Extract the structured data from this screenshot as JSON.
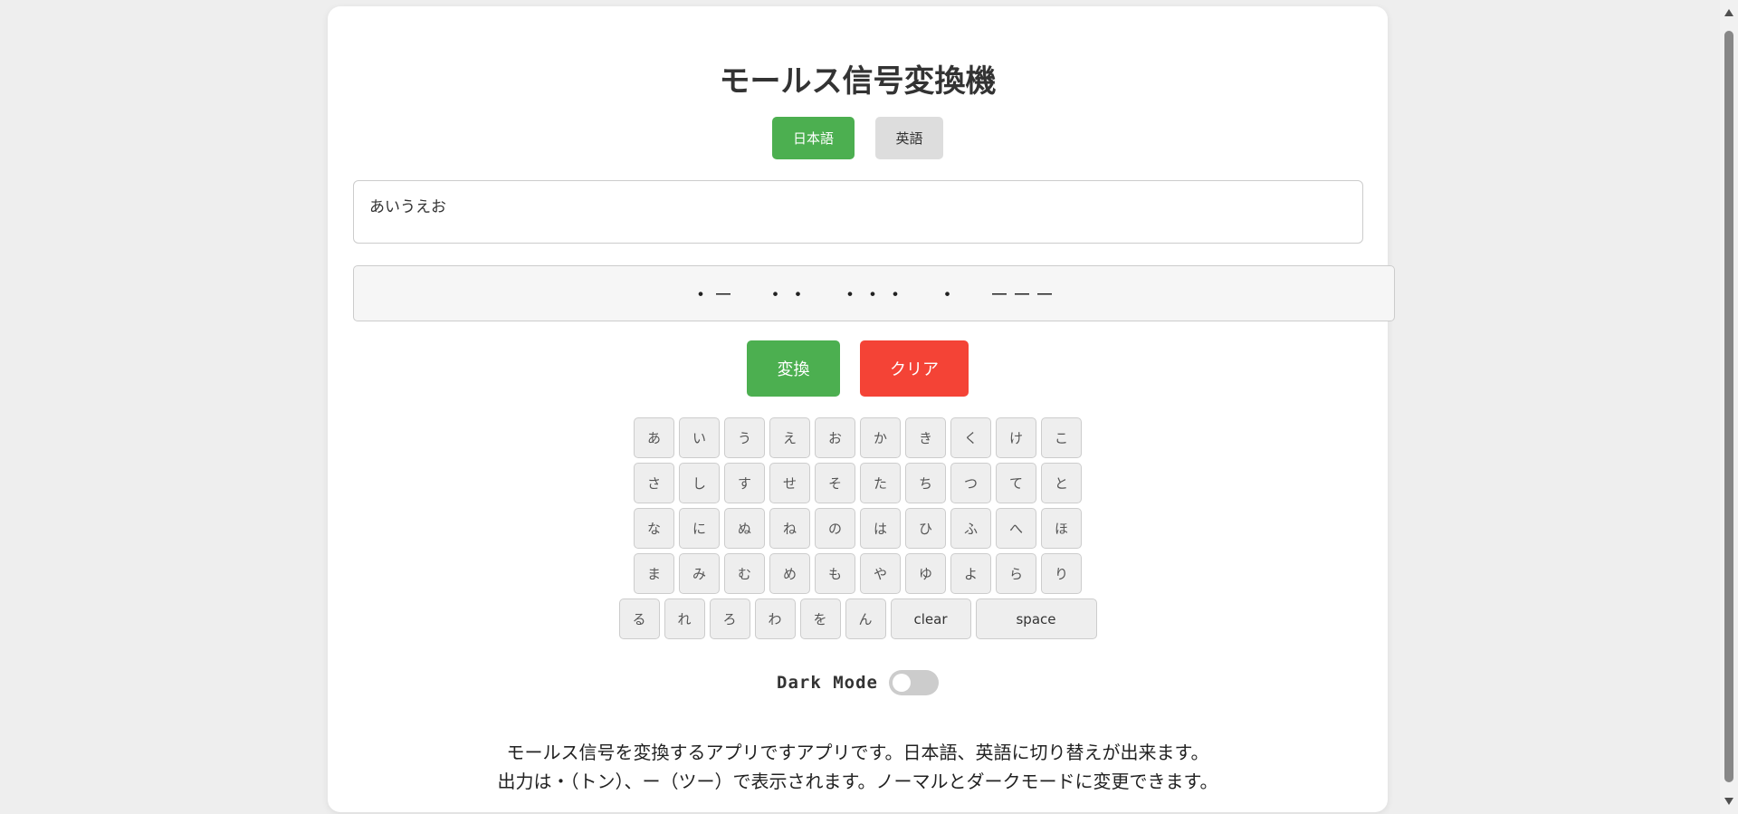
{
  "title": "モールス信号変換機",
  "lang": {
    "japanese": "日本語",
    "english": "英語",
    "active": "japanese"
  },
  "input": {
    "value": "あいうえお"
  },
  "output": {
    "value": "・－  ・・  ・・・  ・  －－－"
  },
  "actions": {
    "convert": "変換",
    "clear": "クリア"
  },
  "keyboard": {
    "rows": [
      [
        "あ",
        "い",
        "う",
        "え",
        "お",
        "か",
        "き",
        "く",
        "け",
        "こ"
      ],
      [
        "さ",
        "し",
        "す",
        "せ",
        "そ",
        "た",
        "ち",
        "つ",
        "て",
        "と"
      ],
      [
        "な",
        "に",
        "ぬ",
        "ね",
        "の",
        "は",
        "ひ",
        "ふ",
        "へ",
        "ほ"
      ],
      [
        "ま",
        "み",
        "む",
        "め",
        "も",
        "や",
        "ゆ",
        "よ",
        "ら",
        "り"
      ],
      [
        "る",
        "れ",
        "ろ",
        "わ",
        "を",
        "ん"
      ]
    ],
    "clear_label": "clear",
    "space_label": "space"
  },
  "dark_mode": {
    "label": "Dark Mode",
    "enabled": false
  },
  "description": {
    "line1": "モールス信号を変換するアプリですアプリです。日本語、英語に切り替えが出来ます。",
    "line2": "出力は・（トン）、ー（ツー）で表示されます。ノーマルとダークモードに変更できます。"
  },
  "colors": {
    "primary_green": "#4caf50",
    "danger_red": "#f44336",
    "background": "#eeeeee"
  }
}
